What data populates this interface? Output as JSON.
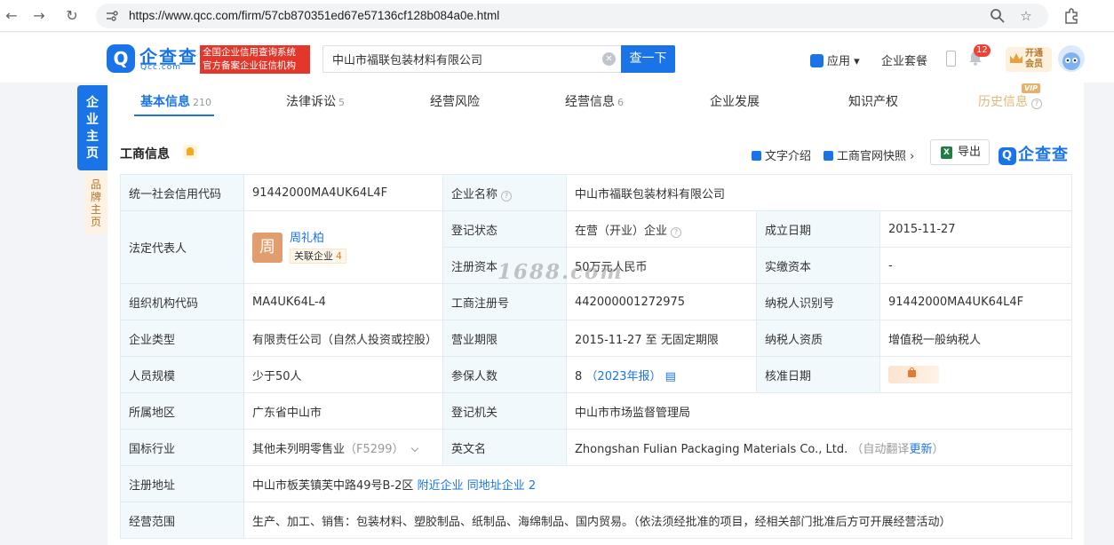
{
  "browser": {
    "url": "https://www.qcc.com/firm/57cb870351ed67e57136cf128b084a0e.html"
  },
  "header": {
    "logo_text": "企查查",
    "logo_sub": "Qcc.com",
    "slogan_line1": "全国企业信用查询系统",
    "slogan_line2": "官方备案企业征信机构",
    "search_value": "中山市福联包装材料有限公司",
    "search_button": "查一下",
    "apps_label": "应用",
    "suite_label": "企业套餐",
    "notification_count": "12",
    "vip_line1": "开通",
    "vip_line2": "会员"
  },
  "side_tabs": {
    "main": [
      "企",
      "业",
      "主",
      "页"
    ],
    "brand": [
      "品",
      "牌",
      "主",
      "页"
    ]
  },
  "tabs": [
    {
      "label": "基本信息",
      "count": "210"
    },
    {
      "label": "法律诉讼",
      "count": "5"
    },
    {
      "label": "经营风险",
      "count": ""
    },
    {
      "label": "经营信息",
      "count": "6"
    },
    {
      "label": "企业发展",
      "count": ""
    },
    {
      "label": "知识产权",
      "count": ""
    },
    {
      "label": "历史信息",
      "count": ""
    }
  ],
  "vip_tag": "VIP",
  "section": {
    "title": "工商信息",
    "text_intro": "文字介绍",
    "snapshot": "工商官网快照",
    "export": "导出",
    "brand": "企查查"
  },
  "info": {
    "credit_code_label": "统一社会信用代码",
    "credit_code": "91442000MA4UK64L4F",
    "company_name_label": "企业名称",
    "company_name": "中山市福联包装材料有限公司",
    "legal_rep_label": "法定代表人",
    "legal_rep_avatar": "周",
    "legal_rep_name": "周礼柏",
    "legal_rep_related": "关联企业",
    "legal_rep_related_count": "4",
    "reg_status_label": "登记状态",
    "reg_status": "在营（开业）企业",
    "founded_label": "成立日期",
    "founded": "2015-11-27",
    "reg_capital_label": "注册资本",
    "reg_capital": "50万元人民币",
    "paid_capital_label": "实缴资本",
    "paid_capital": "-",
    "org_code_label": "组织机构代码",
    "org_code": "MA4UK64L-4",
    "biz_reg_no_label": "工商注册号",
    "biz_reg_no": "442000001272975",
    "taxpayer_id_label": "纳税人识别号",
    "taxpayer_id": "91442000MA4UK64L4F",
    "company_type_label": "企业类型",
    "company_type": "有限责任公司（自然人投资或控股）",
    "biz_term_label": "营业期限",
    "biz_term": "2015-11-27 至 无固定期限",
    "taxpayer_qual_label": "纳税人资质",
    "taxpayer_qual": "增值税一般纳税人",
    "staff_size_label": "人员规模",
    "staff_size": "少于50人",
    "insured_label": "参保人数",
    "insured_count": "8",
    "insured_year": "（2023年报）",
    "approval_date_label": "核准日期",
    "region_label": "所属地区",
    "region": "广东省中山市",
    "reg_authority_label": "登记机关",
    "reg_authority": "中山市市场监督管理局",
    "industry_label": "国标行业",
    "industry": "其他未列明零售业",
    "industry_code": "（F5299）",
    "english_name_label": "英文名",
    "english_name": "Zhongshan Fulian Packaging Materials Co., Ltd.",
    "auto_translate": "（自动翻译",
    "update_link": "更新",
    "auto_translate_end": "）",
    "address_label": "注册地址",
    "address": "中山市板芙镇芙中路49号B-2区",
    "nearby_link": "附近企业",
    "same_address_link": "同地址企业",
    "same_address_count": "2",
    "scope_label": "经营范围",
    "scope": "生产、加工、销售：包装材料、塑胶制品、纸制品、海绵制品、国内贸易。（依法须经批准的项目，经相关部门批准后方可开展经营活动）"
  },
  "watermark": "1688.com",
  "colors": {
    "brand_blue": "#1a74e8",
    "label_bg": "#f2f9fc",
    "slogan_red": "#e3372c",
    "avatar_orange": "#e19d6e"
  }
}
